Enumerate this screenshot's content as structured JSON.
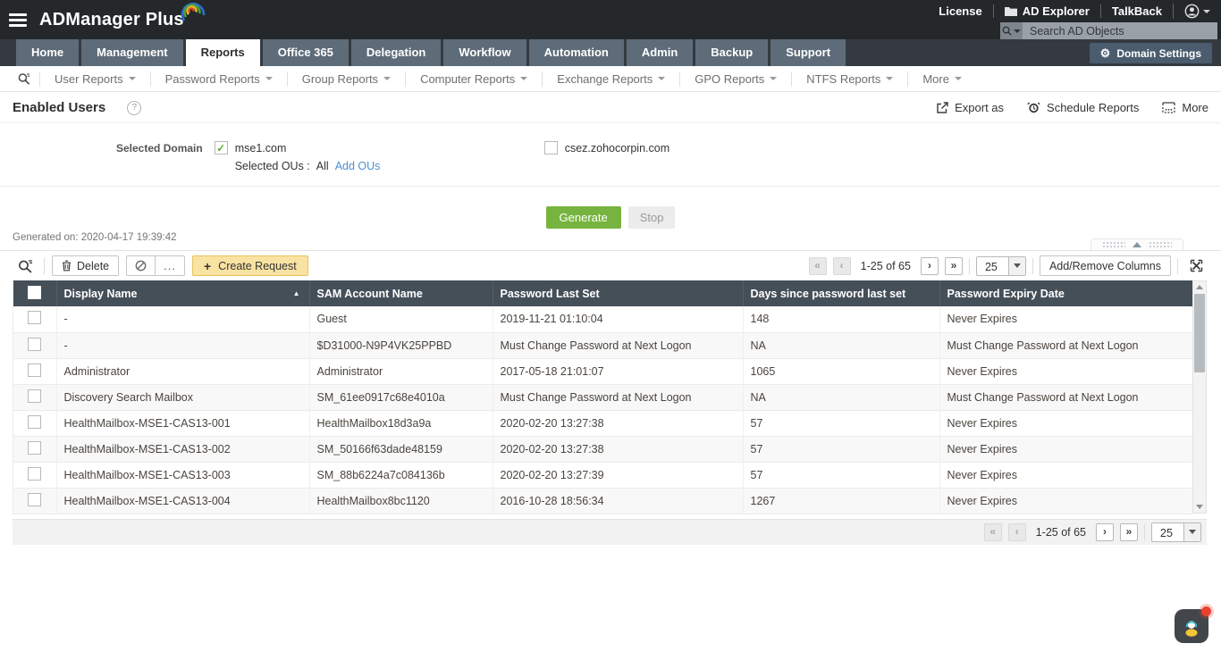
{
  "topbar": {
    "brand": "ADManager Plus",
    "links": [
      {
        "label": "License",
        "icon": null
      },
      {
        "label": "AD Explorer",
        "icon": "folder-icon"
      },
      {
        "label": "TalkBack",
        "icon": null
      }
    ],
    "search": {
      "placeholder": "Search AD Objects"
    }
  },
  "nav": {
    "tabs": [
      {
        "label": "Home",
        "active": false
      },
      {
        "label": "Management",
        "active": false
      },
      {
        "label": "Reports",
        "active": true
      },
      {
        "label": "Office 365",
        "active": false
      },
      {
        "label": "Delegation",
        "active": false
      },
      {
        "label": "Workflow",
        "active": false
      },
      {
        "label": "Automation",
        "active": false
      },
      {
        "label": "Admin",
        "active": false
      },
      {
        "label": "Backup",
        "active": false
      },
      {
        "label": "Support",
        "active": false
      }
    ],
    "domain_settings_label": "Domain Settings"
  },
  "subnav": {
    "items": [
      "User Reports",
      "Password Reports",
      "Group Reports",
      "Computer Reports",
      "Exchange Reports",
      "GPO Reports",
      "NTFS Reports",
      "More"
    ]
  },
  "report": {
    "title": "Enabled Users",
    "help_glyph": "?",
    "actions": [
      {
        "label": "Export as",
        "icon": "export-icon"
      },
      {
        "label": "Schedule Reports",
        "icon": "schedule-icon"
      },
      {
        "label": "More",
        "icon": "more-grid-icon"
      }
    ],
    "domain_section": {
      "label": "Selected Domain",
      "domains": [
        {
          "name": "mse1.com",
          "checked": true,
          "show_ous": true
        },
        {
          "name": "csez.zohocorpin.com",
          "checked": false,
          "show_ous": false
        }
      ],
      "selected_ous_label": "Selected OUs :",
      "selected_ous_value": "All",
      "add_ous_link": "Add OUs"
    },
    "generate_label": "Generate",
    "stop_label": "Stop",
    "generated_on": "Generated on: 2020-04-17 19:39:42"
  },
  "toolbar": {
    "delete_label": "Delete",
    "ellipsis_label": "...",
    "create_request_label": "Create Request",
    "plus_glyph": "+"
  },
  "pagination": {
    "first": "«",
    "prev": "‹",
    "range": "1-25 of 65",
    "next": "›",
    "last": "»",
    "page_size": "25",
    "add_remove_columns_label": "Add/Remove Columns"
  },
  "table": {
    "columns": [
      "Display Name",
      "SAM Account Name",
      "Password Last Set",
      "Days since password last set",
      "Password Expiry Date"
    ],
    "sort": {
      "column": "Display Name",
      "direction": "asc"
    },
    "rows": [
      [
        "-",
        "Guest",
        "2019-11-21 01:10:04",
        "148",
        "Never Expires"
      ],
      [
        "-",
        "$D31000-N9P4VK25PPBD",
        "Must Change Password at Next Logon",
        "NA",
        "Must Change Password at Next Logon"
      ],
      [
        "Administrator",
        "Administrator",
        "2017-05-18 21:01:07",
        "1065",
        "Never Expires"
      ],
      [
        "Discovery Search Mailbox",
        "SM_61ee0917c68e4010a",
        "Must Change Password at Next Logon",
        "NA",
        "Must Change Password at Next Logon"
      ],
      [
        "HealthMailbox-MSE1-CAS13-001",
        "HealthMailbox18d3a9a",
        "2020-02-20 13:27:38",
        "57",
        "Never Expires"
      ],
      [
        "HealthMailbox-MSE1-CAS13-002",
        "SM_50166f63dade48159",
        "2020-02-20 13:27:38",
        "57",
        "Never Expires"
      ],
      [
        "HealthMailbox-MSE1-CAS13-003",
        "SM_88b6224a7c084136b",
        "2020-02-20 13:27:39",
        "57",
        "Never Expires"
      ],
      [
        "HealthMailbox-MSE1-CAS13-004",
        "HealthMailbox8bc1120",
        "2016-10-28 18:56:34",
        "1267",
        "Never Expires"
      ]
    ]
  },
  "colors": {
    "topbar_bg": "#24282b",
    "tab_bg": "#5d6c78",
    "table_header_bg": "#454f58",
    "accent_green": "#76b43f",
    "create_request_bg": "#f9e3a3",
    "link_blue": "#4a90d2",
    "check_green": "#5fae2d"
  }
}
